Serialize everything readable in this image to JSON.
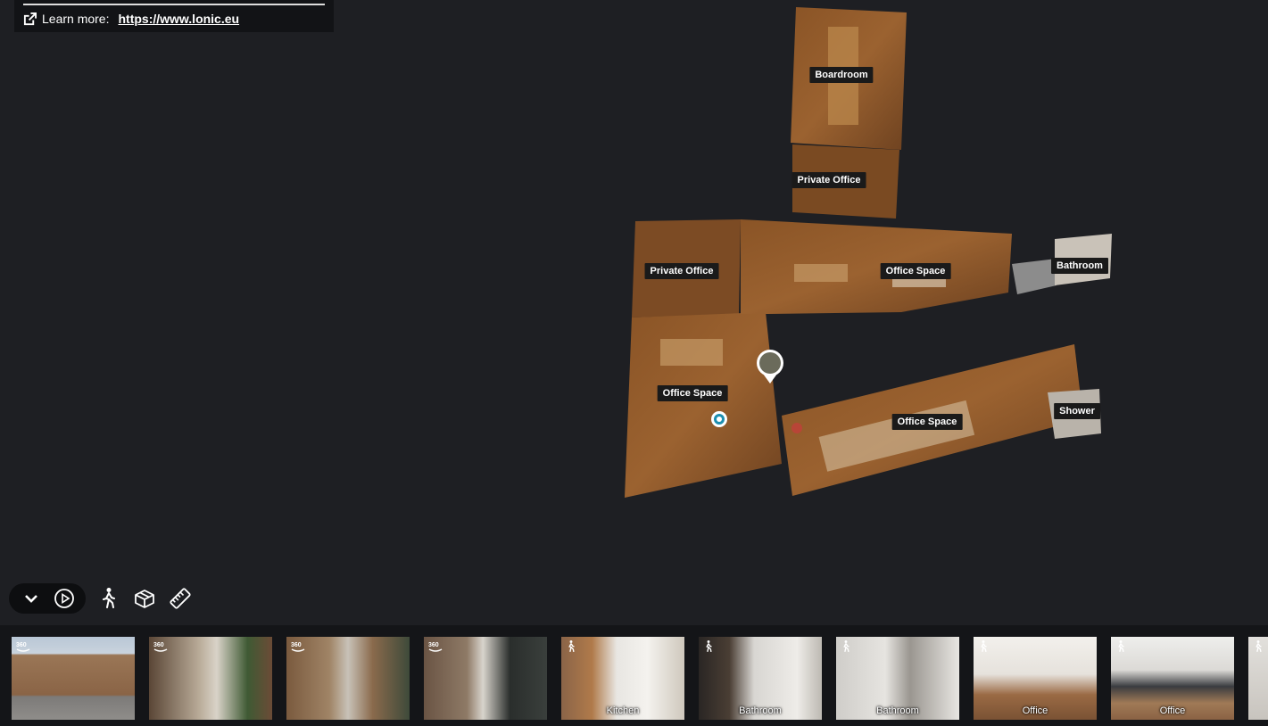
{
  "learn_more": {
    "label": "Learn more:",
    "url_text": "https://www.lonic.eu"
  },
  "rooms": [
    {
      "label": "Boardroom"
    },
    {
      "label": "Private Office"
    },
    {
      "label": "Private Office"
    },
    {
      "label": "Office Space"
    },
    {
      "label": "Bathroom"
    },
    {
      "label": "Office Space"
    },
    {
      "label": "Office Space"
    },
    {
      "label": "Shower"
    }
  ],
  "controls": [
    "collapse",
    "play",
    "walk",
    "dollhouse",
    "measure"
  ],
  "thumbnails": [
    {
      "type": "360",
      "caption": ""
    },
    {
      "type": "360",
      "caption": ""
    },
    {
      "type": "360",
      "caption": ""
    },
    {
      "type": "360",
      "caption": ""
    },
    {
      "type": "walk",
      "caption": "Kitchen"
    },
    {
      "type": "walk",
      "caption": "Bathroom"
    },
    {
      "type": "walk",
      "caption": "Bathroom"
    },
    {
      "type": "walk",
      "caption": "Office"
    },
    {
      "type": "walk",
      "caption": "Office"
    },
    {
      "type": "walk",
      "caption": ""
    }
  ]
}
